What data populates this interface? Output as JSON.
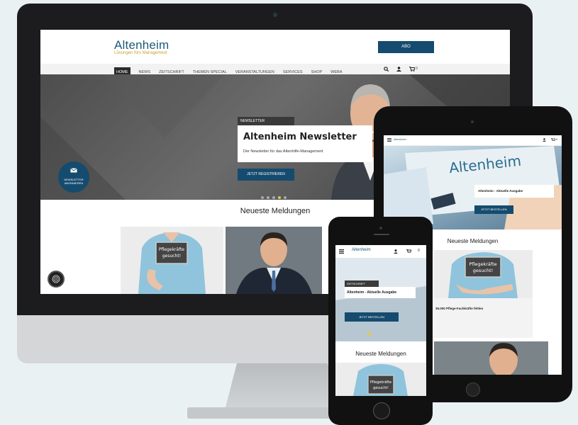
{
  "desktop": {
    "logo": {
      "main": "Altenheim",
      "sub": "Lösungen fürs Management"
    },
    "header_button": "ABO",
    "nav": [
      "HOME",
      "NEWS",
      "ZEITSCHRIFT",
      "THEMEN SPECIAL",
      "VERANSTALTUNGEN",
      "SERVICES",
      "SHOP",
      "WEBA"
    ],
    "cart_count": "0",
    "hero": {
      "tag": "NEWSLETTER",
      "title": "Altenheim Newsletter",
      "description": "Der Newsletter für das Altenhilfe-Management",
      "button": "JETZT REGISTRIEREN",
      "slides": 5,
      "active_slide": 4
    },
    "newsletter_badge": [
      "NEWSLETTER",
      "ABONNIEREN"
    ],
    "section_title": "Neueste Meldungen",
    "sign_text": "Pflegekräfte gesucht!"
  },
  "tablet": {
    "logo": "Altenheim",
    "cart_count": "0",
    "magazine_title": "Altenheim",
    "hero_title": "Altenheim - Aktuelle Ausgabe",
    "hero_button": "JETZT BESTELLEN",
    "section_title": "Neueste Meldungen",
    "sign_text": "Pflegekräfte gesucht!",
    "article_title": "35.000 Pflege-Fachkräfte fehlen"
  },
  "phone": {
    "logo": "Altenheim",
    "cart_count": "0",
    "hero_tag": "ZEITSCHRIFT",
    "hero_title": "Altenheim - Aktuelle Ausgabe",
    "hero_button": "JETZT BESTELLEN",
    "section_title": "Neueste Meldungen",
    "sign_text": "Pflegekräfte gesucht!"
  },
  "colors": {
    "brand_navy": "#154b6e",
    "logo_blue": "#1b5a7a",
    "logo_gold": "#c9a22a",
    "dot_active": "#e6c94a"
  }
}
